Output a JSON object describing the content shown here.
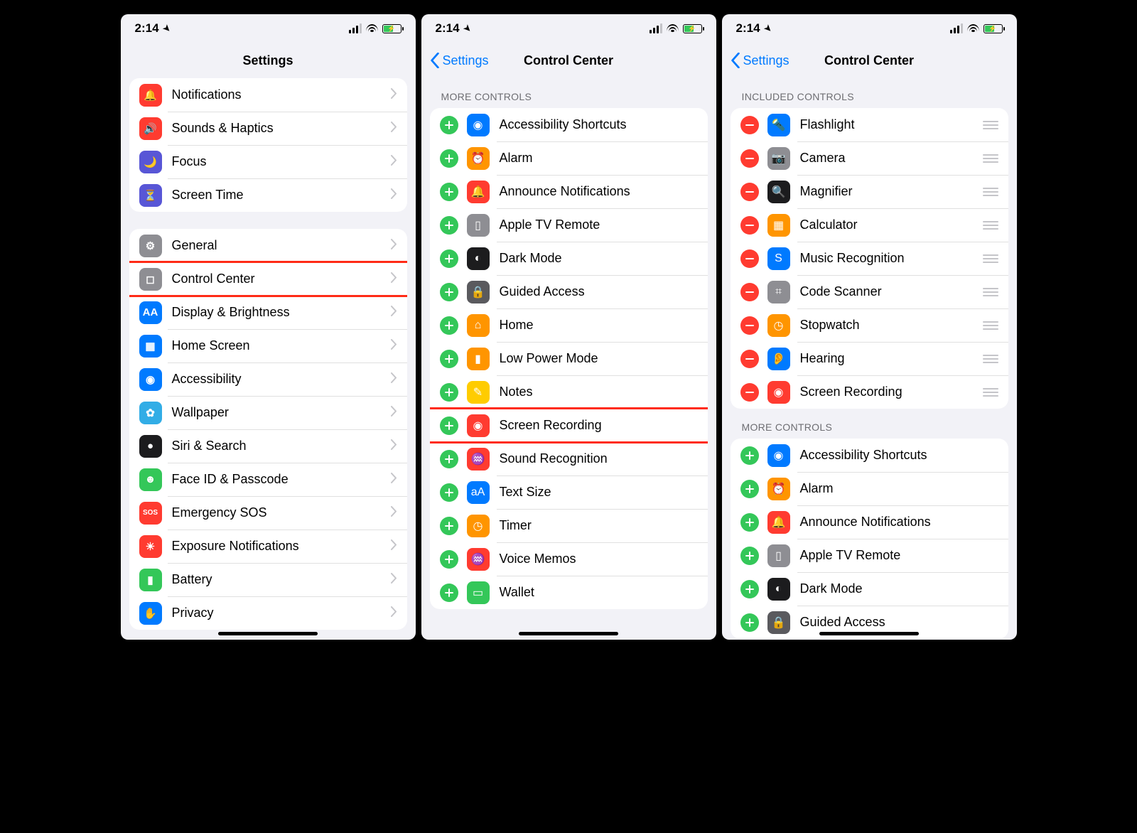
{
  "status": {
    "time": "2:14"
  },
  "colors": {
    "red": "#ff3b30",
    "orange": "#ff9500",
    "yellow": "#ffcc00",
    "green": "#34c759",
    "blue": "#007aff",
    "indigo": "#5856d6",
    "gray": "#8e8e93",
    "darkgray": "#5a5a5e",
    "black": "#1c1c1e",
    "teal": "#32ade6",
    "pink": "#ff2d55",
    "cyan": "#5ac8fa"
  },
  "screen1": {
    "title": "Settings",
    "groups": [
      {
        "rows": [
          {
            "key": "notifications",
            "label": "Notifications",
            "iconColor": "red",
            "glyph": "🔔"
          },
          {
            "key": "sounds-haptics",
            "label": "Sounds & Haptics",
            "iconColor": "red",
            "glyph": "🔊"
          },
          {
            "key": "focus",
            "label": "Focus",
            "iconColor": "indigo",
            "glyph": "🌙"
          },
          {
            "key": "screen-time",
            "label": "Screen Time",
            "iconColor": "indigo",
            "glyph": "⏳"
          }
        ]
      },
      {
        "rows": [
          {
            "key": "general",
            "label": "General",
            "iconColor": "gray",
            "glyph": "⚙"
          },
          {
            "key": "control-center",
            "label": "Control Center",
            "iconColor": "gray",
            "glyph": "◻",
            "highlight": true
          },
          {
            "key": "display-brightness",
            "label": "Display & Brightness",
            "iconColor": "blue",
            "glyph": "AA"
          },
          {
            "key": "home-screen",
            "label": "Home Screen",
            "iconColor": "blue",
            "glyph": "▦"
          },
          {
            "key": "accessibility",
            "label": "Accessibility",
            "iconColor": "blue",
            "glyph": "◉"
          },
          {
            "key": "wallpaper",
            "label": "Wallpaper",
            "iconColor": "teal",
            "glyph": "✿"
          },
          {
            "key": "siri-search",
            "label": "Siri & Search",
            "iconColor": "black",
            "glyph": "●"
          },
          {
            "key": "face-id-passcode",
            "label": "Face ID & Passcode",
            "iconColor": "green",
            "glyph": "☻"
          },
          {
            "key": "emergency-sos",
            "label": "Emergency SOS",
            "iconColor": "red",
            "glyph": "SOS"
          },
          {
            "key": "exposure-notifications",
            "label": "Exposure Notifications",
            "iconColor": "red",
            "glyph": "☀"
          },
          {
            "key": "battery",
            "label": "Battery",
            "iconColor": "green",
            "glyph": "▮"
          },
          {
            "key": "privacy",
            "label": "Privacy",
            "iconColor": "blue",
            "glyph": "✋"
          }
        ]
      }
    ]
  },
  "screen2": {
    "back": "Settings",
    "title": "Control Center",
    "header": "More Controls",
    "rows": [
      {
        "key": "accessibility-shortcuts",
        "label": "Accessibility Shortcuts",
        "iconColor": "blue",
        "glyph": "◉"
      },
      {
        "key": "alarm",
        "label": "Alarm",
        "iconColor": "orange",
        "glyph": "⏰"
      },
      {
        "key": "announce-notifications",
        "label": "Announce Notifications",
        "iconColor": "red",
        "glyph": "🔔"
      },
      {
        "key": "apple-tv-remote",
        "label": "Apple TV Remote",
        "iconColor": "gray",
        "glyph": "▯"
      },
      {
        "key": "dark-mode",
        "label": "Dark Mode",
        "iconColor": "black",
        "glyph": "◐"
      },
      {
        "key": "guided-access",
        "label": "Guided Access",
        "iconColor": "darkgray",
        "glyph": "🔒"
      },
      {
        "key": "home",
        "label": "Home",
        "iconColor": "orange",
        "glyph": "⌂"
      },
      {
        "key": "low-power-mode",
        "label": "Low Power Mode",
        "iconColor": "orange",
        "glyph": "▮"
      },
      {
        "key": "notes",
        "label": "Notes",
        "iconColor": "yellow",
        "glyph": "✎"
      },
      {
        "key": "screen-recording",
        "label": "Screen Recording",
        "iconColor": "red",
        "glyph": "◉",
        "highlight": true
      },
      {
        "key": "sound-recognition",
        "label": "Sound Recognition",
        "iconColor": "red",
        "glyph": "♒"
      },
      {
        "key": "text-size",
        "label": "Text Size",
        "iconColor": "blue",
        "glyph": "aA"
      },
      {
        "key": "timer",
        "label": "Timer",
        "iconColor": "orange",
        "glyph": "◷"
      },
      {
        "key": "voice-memos",
        "label": "Voice Memos",
        "iconColor": "red",
        "glyph": "♒"
      },
      {
        "key": "wallet",
        "label": "Wallet",
        "iconColor": "green",
        "glyph": "▭"
      }
    ]
  },
  "screen3": {
    "back": "Settings",
    "title": "Control Center",
    "included": {
      "header": "Included Controls",
      "rows": [
        {
          "key": "flashlight",
          "label": "Flashlight",
          "iconColor": "blue",
          "glyph": "🔦"
        },
        {
          "key": "camera",
          "label": "Camera",
          "iconColor": "gray",
          "glyph": "📷"
        },
        {
          "key": "magnifier",
          "label": "Magnifier",
          "iconColor": "black",
          "glyph": "🔍"
        },
        {
          "key": "calculator",
          "label": "Calculator",
          "iconColor": "orange",
          "glyph": "▦"
        },
        {
          "key": "music-recognition",
          "label": "Music Recognition",
          "iconColor": "blue",
          "glyph": "S"
        },
        {
          "key": "code-scanner",
          "label": "Code Scanner",
          "iconColor": "gray",
          "glyph": "⌗"
        },
        {
          "key": "stopwatch",
          "label": "Stopwatch",
          "iconColor": "orange",
          "glyph": "◷"
        },
        {
          "key": "hearing",
          "label": "Hearing",
          "iconColor": "blue",
          "glyph": "👂"
        },
        {
          "key": "screen-recording",
          "label": "Screen Recording",
          "iconColor": "red",
          "glyph": "◉"
        }
      ]
    },
    "more": {
      "header": "More Controls",
      "rows": [
        {
          "key": "accessibility-shortcuts",
          "label": "Accessibility Shortcuts",
          "iconColor": "blue",
          "glyph": "◉"
        },
        {
          "key": "alarm",
          "label": "Alarm",
          "iconColor": "orange",
          "glyph": "⏰"
        },
        {
          "key": "announce-notifications",
          "label": "Announce Notifications",
          "iconColor": "red",
          "glyph": "🔔"
        },
        {
          "key": "apple-tv-remote",
          "label": "Apple TV Remote",
          "iconColor": "gray",
          "glyph": "▯"
        },
        {
          "key": "dark-mode",
          "label": "Dark Mode",
          "iconColor": "black",
          "glyph": "◐"
        },
        {
          "key": "guided-access",
          "label": "Guided Access",
          "iconColor": "darkgray",
          "glyph": "🔒"
        }
      ]
    }
  }
}
